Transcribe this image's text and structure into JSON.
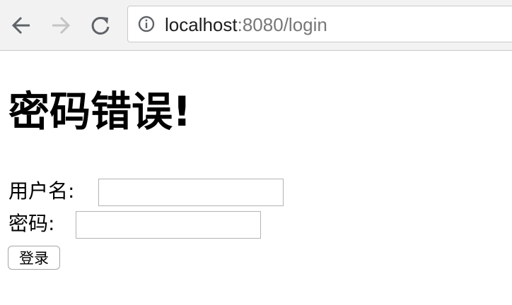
{
  "browser": {
    "url_host": "localhost",
    "url_rest": ":8080/login",
    "icons": {
      "back": "arrow-left-icon",
      "forward": "arrow-right-icon",
      "reload": "reload-icon",
      "site_info": "info-circle-icon"
    },
    "forward_enabled": false
  },
  "page": {
    "title": "密码错误!",
    "form": {
      "username_label": "用户名:",
      "username_value": "",
      "password_label": "密码:",
      "password_value": "",
      "submit_label": "登录"
    }
  }
}
